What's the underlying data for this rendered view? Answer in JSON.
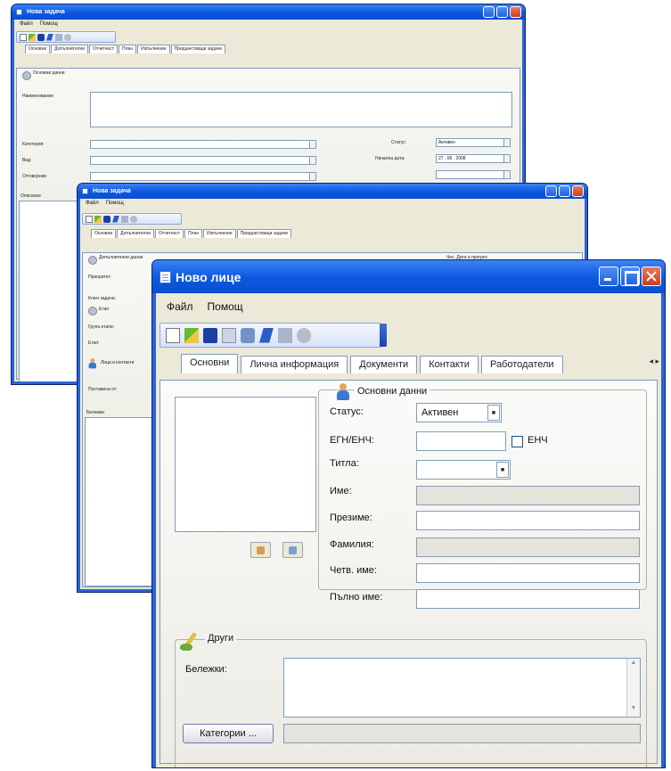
{
  "task_window_1": {
    "title": "Нова задача",
    "menu": [
      "Файл",
      "Помощ"
    ],
    "tabs": [
      "Основни",
      "Допълнителни",
      "Отчетност",
      "План",
      "Изпълнение",
      "Предшестващи задачи"
    ],
    "group_title": "Основни данни",
    "labels": {
      "name": "Наименование:",
      "category": "Категория:",
      "type": "Вид:",
      "responsible": "Отговорник:",
      "status": "Статус:",
      "start_date": "Начална дата:",
      "description": "Описание"
    },
    "values": {
      "status": "Активен",
      "start_date": "27 . 06 . 2008"
    }
  },
  "task_window_2": {
    "title": "Нова задача",
    "menu": [
      "Файл",
      "Помощ"
    ],
    "tabs": [
      "Основни",
      "Допълнителни",
      "Отчетност",
      "План",
      "Изпълнение",
      "Предшестващи задачи"
    ],
    "groups": {
      "additional": "Допълнителни данни",
      "stage": "Етап",
      "persons": "Лица и контакти",
      "dates": "Чес. Дата и прогрес"
    },
    "labels": {
      "priority": "Приоритет:",
      "key_task": "Ключ задача:",
      "stage_group": "Група етапи:",
      "stage": "Етап:",
      "assigned_by": "Поставена от:",
      "notes": "Бележки"
    }
  },
  "person_window": {
    "title": "Ново лице",
    "menu": [
      "Файл",
      "Помощ"
    ],
    "tabs": [
      "Основни",
      "Лична информация",
      "Документи",
      "Контакти",
      "Работодатели"
    ],
    "tab_scroll": "◂ ▸",
    "basic_group_title": "Основни данни",
    "fields": {
      "status_label": "Статус:",
      "status_value": "Активен",
      "egn_label": "ЕГН/ЕНЧ:",
      "egn_value": "",
      "enc_checkbox_label": "ЕНЧ",
      "title_label": "Титла:",
      "title_value": "",
      "first_name_label": "Име:",
      "middle_name_label": "Презиме:",
      "last_name_label": "Фамилия:",
      "read_name_label": "Четв. име:",
      "full_name_label": "Пълно име:"
    },
    "other_group_title": "Други",
    "notes_label": "Бележки:",
    "categories_button": "Категории ..."
  },
  "colors": {
    "titlebar": "#0a58e0",
    "window_body": "#ece9d8",
    "close_button": "#c9401c"
  }
}
